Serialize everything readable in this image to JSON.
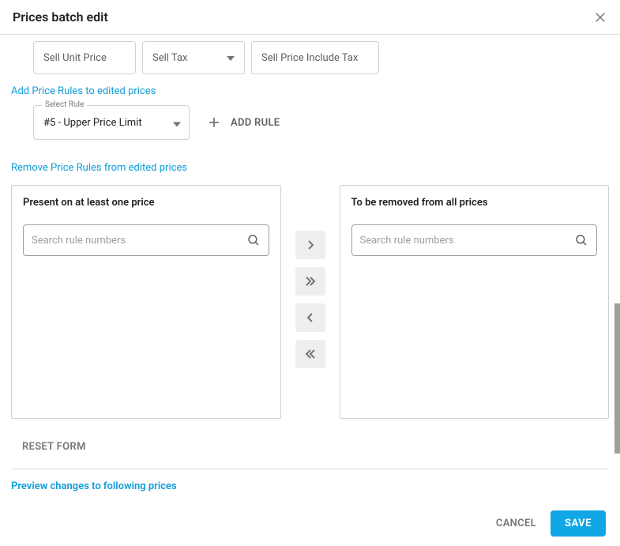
{
  "header": {
    "title": "Prices batch edit"
  },
  "fields": {
    "sell_unit": "Sell Unit Price",
    "sell_tax": "Sell Tax",
    "sell_inc": "Sell Price Include Tax"
  },
  "add_rules": {
    "heading": "Add Price Rules to edited prices",
    "select_label": "Select Rule",
    "selected": "#5 - Upper Price Limit",
    "add_button": "ADD RULE"
  },
  "remove_rules": {
    "heading": "Remove Price Rules from edited prices",
    "left_title": "Present on at least one price",
    "right_title": "To be removed from all prices",
    "search_placeholder": "Search rule numbers"
  },
  "reset": "RESET FORM",
  "preview": "Preview changes to following prices",
  "footer": {
    "cancel": "CANCEL",
    "save": "SAVE"
  }
}
